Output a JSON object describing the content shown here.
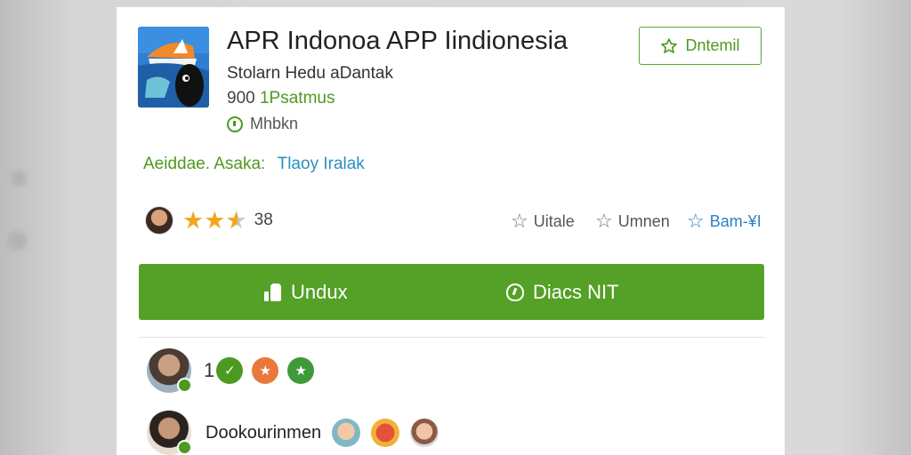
{
  "app": {
    "title": "APR Indonoa APP Iindionesia",
    "developer": "Stolarn Hedu aDantak",
    "downloads_number": "900",
    "downloads_unit": "1Psatmus",
    "verified_text": "Mhbkn",
    "icon": "app-logo-icon"
  },
  "wishlist": {
    "label": "Dntemil",
    "icon": "star-outline-icon"
  },
  "tags": {
    "primary": "Aeiddae. Asaka:",
    "secondary": "Tlaoy Iralak"
  },
  "rating": {
    "stars": 2.5,
    "count": "38"
  },
  "meta_links": [
    {
      "label": "Uitale",
      "icon": "star-outline-icon"
    },
    {
      "label": "Umnen",
      "icon": "star-outline-icon"
    },
    {
      "label": "Bam-¥I",
      "icon": "star-outline-icon"
    }
  ],
  "actions": {
    "install_label": "Undux",
    "install_icon": "thumbs-up-icon",
    "secondary_label": "Diacs NIT",
    "secondary_icon": "shield-icon"
  },
  "reviews": {
    "count": "1",
    "badges": [
      {
        "symbol": "✓",
        "color": "#4d9a22"
      },
      {
        "symbol": "★",
        "color": "#e9793a"
      },
      {
        "symbol": "★",
        "color": "#3f9a3a"
      }
    ],
    "reviewer_name": "Dookourinmen"
  },
  "colors": {
    "accent_green": "#55a026",
    "link_blue": "#2b7fc3"
  }
}
